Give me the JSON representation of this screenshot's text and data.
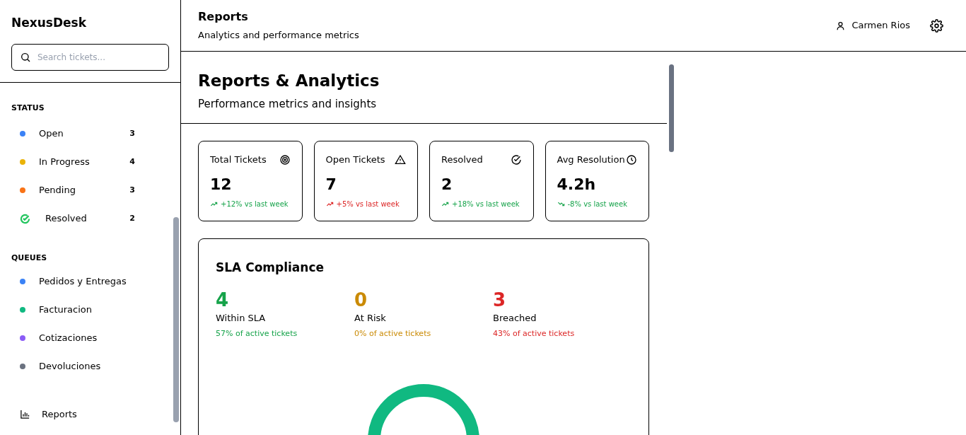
{
  "sidebar": {
    "brand": "NexusDesk",
    "search": {
      "placeholder": "Search tickets..."
    },
    "status_heading": "STATUS",
    "status_items": [
      {
        "kind": "dot",
        "label": "Open",
        "count": "3",
        "color": "#3b82f6"
      },
      {
        "kind": "dot",
        "label": "In Progress",
        "count": "4",
        "color": "#eab308"
      },
      {
        "kind": "dot",
        "label": "Pending",
        "count": "3",
        "color": "#f97316"
      },
      {
        "kind": "check",
        "label": "Resolved",
        "count": "2",
        "color": "#22c55e"
      }
    ],
    "queues_heading": "QUEUES",
    "queues": [
      {
        "label": "Pedidos y Entregas",
        "color": "#3b82f6"
      },
      {
        "label": "Facturacion",
        "color": "#10b981"
      },
      {
        "label": "Cotizaciones",
        "color": "#8b5cf6"
      },
      {
        "label": "Devoluciones",
        "color": "#6b7280"
      }
    ],
    "footer_link": "Reports"
  },
  "header": {
    "title": "Reports",
    "subtitle": "Analytics and performance metrics",
    "user": "Carmen Rios"
  },
  "page": {
    "title": "Reports & Analytics",
    "subtitle": "Performance metrics and insights"
  },
  "stats": [
    {
      "kind": "up",
      "color": "#16a34a",
      "label": "Total Tickets",
      "value": "12",
      "change": "+12% vs last week"
    },
    {
      "kind": "up",
      "color": "#dc2626",
      "label": "Open Tickets",
      "value": "7",
      "change": "+5% vs last week"
    },
    {
      "kind": "up",
      "color": "#16a34a",
      "label": "Resolved",
      "value": "2",
      "change": "+18% vs last week"
    },
    {
      "kind": "down",
      "color": "#16a34a",
      "label": "Avg Resolution",
      "value": "4.2h",
      "change": "-8% vs last week"
    }
  ],
  "sla": {
    "title": "SLA Compliance",
    "items": [
      {
        "value": "4",
        "label": "Within SLA",
        "note": "57% of active tickets",
        "color": "#16a34a"
      },
      {
        "value": "0",
        "label": "At Risk",
        "note": "0% of active tickets",
        "color": "#ca8a04"
      },
      {
        "value": "3",
        "label": "Breached",
        "note": "43% of active tickets",
        "color": "#dc2626"
      }
    ]
  }
}
